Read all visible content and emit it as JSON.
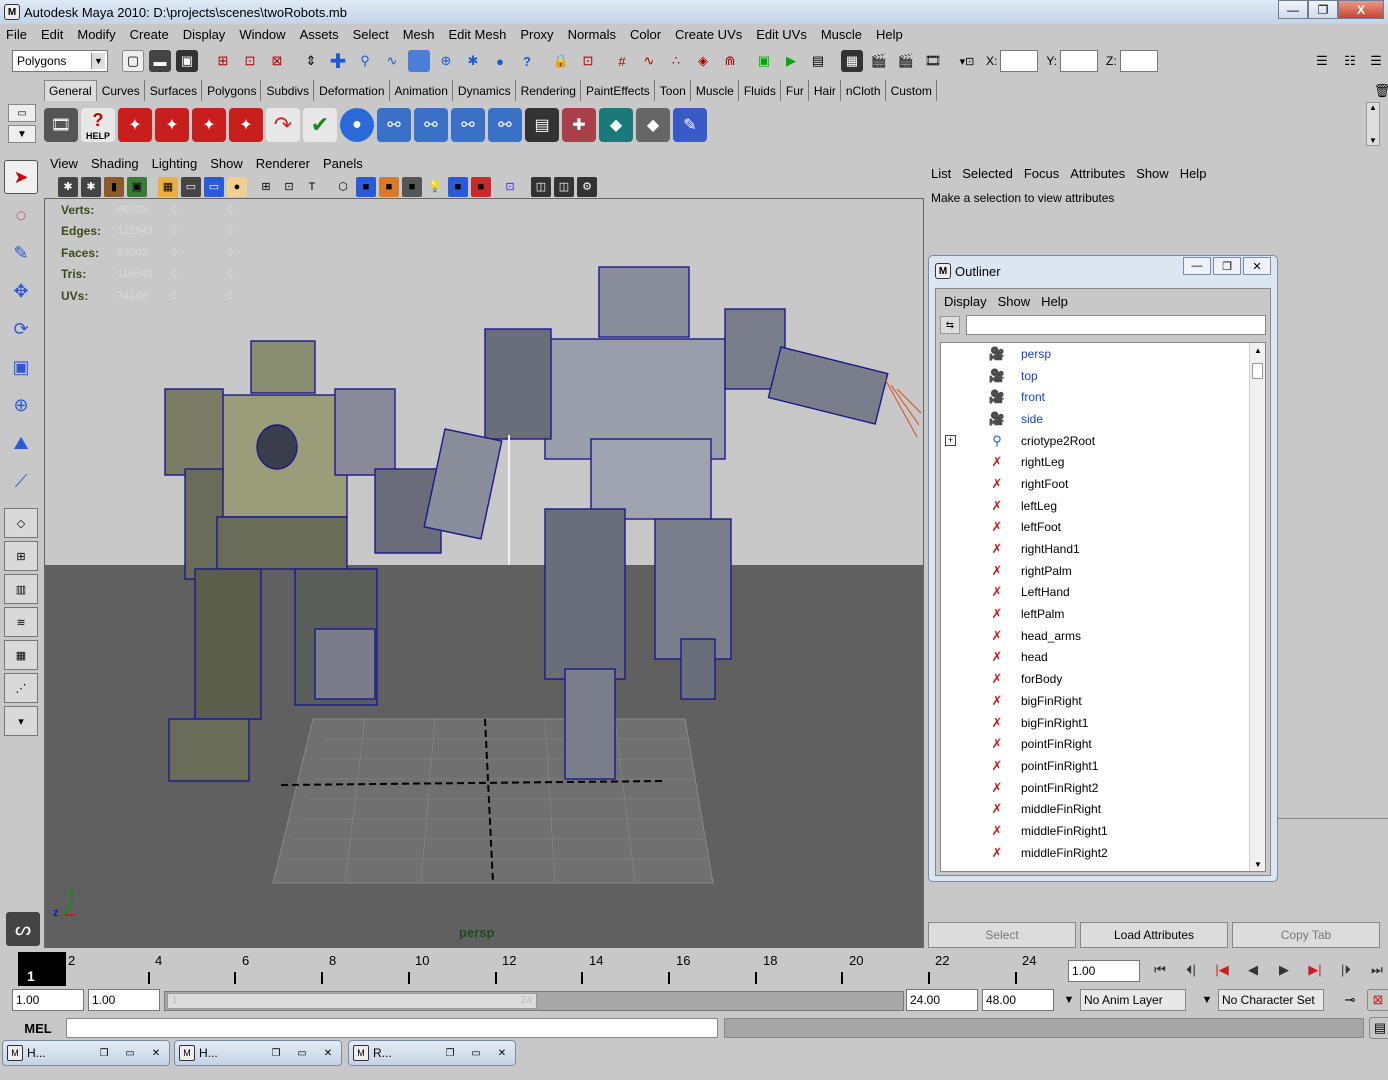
{
  "window": {
    "title": "Autodesk Maya 2010: D:\\projects\\scenes\\twoRobots.mb",
    "controls": [
      "—",
      "❐",
      "X"
    ]
  },
  "menubar": [
    "File",
    "Edit",
    "Modify",
    "Create",
    "Display",
    "Window",
    "Assets",
    "Select",
    "Mesh",
    "Edit Mesh",
    "Proxy",
    "Normals",
    "Color",
    "Create UVs",
    "Edit UVs",
    "Muscle",
    "Help"
  ],
  "statusline": {
    "mode": "Polygons",
    "x_label": "X:",
    "y_label": "Y:",
    "z_label": "Z:"
  },
  "shelf": {
    "tabs": [
      "General",
      "Curves",
      "Surfaces",
      "Polygons",
      "Subdivs",
      "Deformation",
      "Animation",
      "Dynamics",
      "Rendering",
      "PaintEffects",
      "Toon",
      "Muscle",
      "Fluids",
      "Fur",
      "Hair",
      "nCloth",
      "Custom"
    ],
    "active_tab": "General",
    "help_label": "HELP"
  },
  "viewport": {
    "menu": [
      "View",
      "Shading",
      "Lighting",
      "Show",
      "Renderer",
      "Panels"
    ],
    "camera": "persp",
    "axis": {
      "y": "y",
      "z": "z"
    },
    "stats": [
      {
        "label": "Verts:",
        "value": "60333",
        "selected": "0",
        "components": "0"
      },
      {
        "label": "Edges:",
        "value": "122541",
        "selected": "0",
        "components": "0"
      },
      {
        "label": "Faces:",
        "value": "63002",
        "selected": "0",
        "components": "0"
      },
      {
        "label": "Tris:",
        "value": "118542",
        "selected": "0",
        "components": "0"
      },
      {
        "label": "UVs:",
        "value": "74149",
        "selected": "0",
        "components": "0"
      }
    ]
  },
  "attribute_editor": {
    "menu": [
      "List",
      "Selected",
      "Focus",
      "Attributes",
      "Show",
      "Help"
    ],
    "message": "Make a selection to view attributes",
    "buttons": {
      "select": "Select",
      "load": "Load Attributes",
      "copy": "Copy Tab"
    }
  },
  "outliner": {
    "title": "Outliner",
    "menu": [
      "Display",
      "Show",
      "Help"
    ],
    "items": [
      {
        "name": "persp",
        "type": "camera"
      },
      {
        "name": "top",
        "type": "camera"
      },
      {
        "name": "front",
        "type": "camera"
      },
      {
        "name": "side",
        "type": "camera"
      },
      {
        "name": "criotype2Root",
        "type": "joint",
        "expandable": true
      },
      {
        "name": "rightLeg",
        "type": "ik"
      },
      {
        "name": "rightFoot",
        "type": "ik"
      },
      {
        "name": "leftLeg",
        "type": "ik"
      },
      {
        "name": "leftFoot",
        "type": "ik"
      },
      {
        "name": "rightHand1",
        "type": "ik"
      },
      {
        "name": "rightPalm",
        "type": "ik"
      },
      {
        "name": "LeftHand",
        "type": "ik"
      },
      {
        "name": "leftPalm",
        "type": "ik"
      },
      {
        "name": "head_arms",
        "type": "ik"
      },
      {
        "name": "head",
        "type": "ik"
      },
      {
        "name": "forBody",
        "type": "ik"
      },
      {
        "name": "bigFinRight",
        "type": "ik"
      },
      {
        "name": "bigFinRight1",
        "type": "ik"
      },
      {
        "name": "pointFinRight",
        "type": "ik"
      },
      {
        "name": "pointFinRight1",
        "type": "ik"
      },
      {
        "name": "pointFinRight2",
        "type": "ik"
      },
      {
        "name": "middleFinRight",
        "type": "ik"
      },
      {
        "name": "middleFinRight1",
        "type": "ik"
      },
      {
        "name": "middleFinRight2",
        "type": "ik"
      }
    ]
  },
  "timeline": {
    "current_frame": "1",
    "ticks": [
      "2",
      "4",
      "6",
      "8",
      "10",
      "12",
      "14",
      "16",
      "18",
      "20",
      "22",
      "24"
    ],
    "current_time": "1.00"
  },
  "range": {
    "start": "1.00",
    "playback_start": "1.00",
    "slider_start": "1",
    "slider_end": "24",
    "playback_end": "24.00",
    "end": "48.00"
  },
  "anim_layer": "No Anim Layer",
  "character_set": "No Character Set",
  "command_line": {
    "label": "MEL"
  },
  "minimized_windows": [
    {
      "label": "H..."
    },
    {
      "label": "H..."
    },
    {
      "label": "R..."
    }
  ],
  "colors": {
    "ui_gray": "#c8c8c8",
    "viewport_bg": "#c8c8c8",
    "ground": "#606060",
    "wire": "#1a1a8c",
    "camera_text": "#1a3ed8"
  }
}
